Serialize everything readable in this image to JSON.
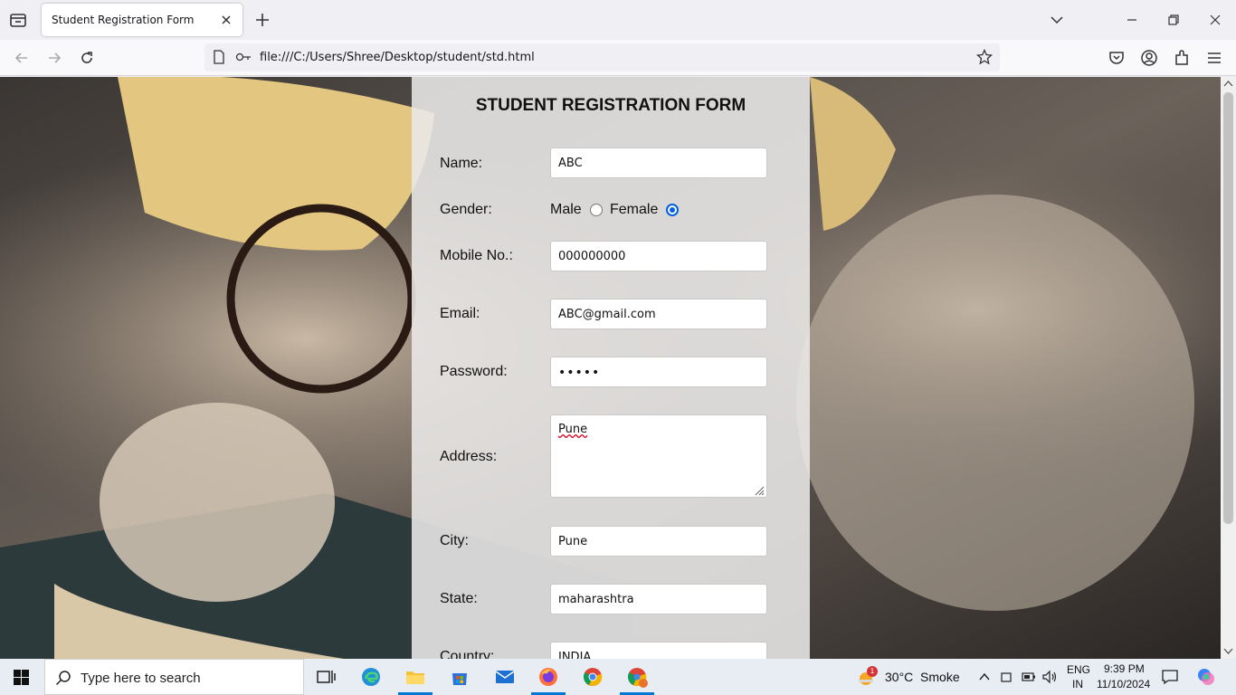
{
  "browser": {
    "tab_title": "Student Registration Form",
    "url": "file:///C:/Users/Shree/Desktop/student/std.html"
  },
  "form": {
    "title": "STUDENT REGISTRATION FORM",
    "name_label": "Name:",
    "name_value": "ABC",
    "gender_label": "Gender:",
    "gender_male": "Male",
    "gender_female": "Female",
    "gender_selected": "Female",
    "mobile_label": "Mobile No.:",
    "mobile_value": "000000000",
    "email_label": "Email:",
    "email_value": "ABC@gmail.com",
    "password_label": "Password:",
    "password_value": "•••••",
    "address_label": "Address:",
    "address_value": "Pune",
    "city_label": "City:",
    "city_value": "Pune",
    "state_label": "State:",
    "state_value": "maharashtra",
    "country_label": "Country:",
    "country_value": "INDIA"
  },
  "taskbar": {
    "search_placeholder": "Type here to search",
    "weather": "30°C  Smoke",
    "weather_badge": "1",
    "lang1": "ENG",
    "lang2": "IN",
    "time": "9:39 PM",
    "date": "11/10/2024"
  },
  "colors": {
    "accent": "#0060df",
    "taskbar_accent": "#0078d4"
  }
}
